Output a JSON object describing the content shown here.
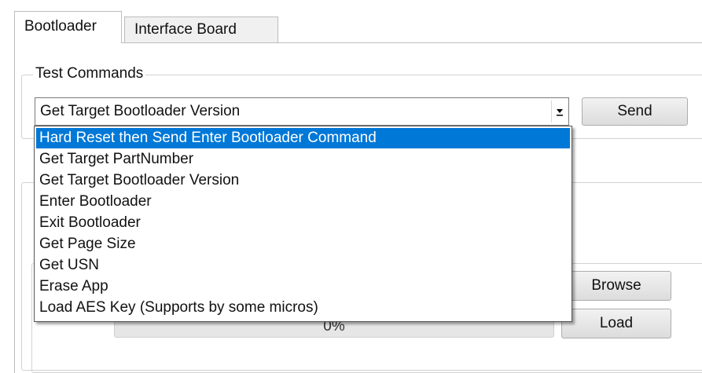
{
  "tabs": [
    {
      "label": "Bootloader",
      "active": true
    },
    {
      "label": "Interface Board",
      "active": false
    }
  ],
  "test_commands": {
    "title": "Test Commands",
    "combo_value": "Get Target Bootloader Version",
    "combo_arrow_icon": "dropdown-arrow-icon",
    "send_label": "Send"
  },
  "dropdown": {
    "items": [
      "Hard Reset then Send Enter Bootloader Command",
      "Get Target PartNumber",
      "Get Target Bootloader Version",
      "Enter Bootloader",
      "Exit Bootloader",
      "Get Page Size",
      "Get USN",
      "Erase App",
      "Load AES Key (Supports by some micros)"
    ],
    "highlighted_index": 0
  },
  "file_load": {
    "browse_label": "Browse",
    "load_label": "Load",
    "progress_text": "0%",
    "progress_percent": 0
  },
  "colors": {
    "selection": "#0078d7",
    "progress_fill": "#06b025"
  }
}
